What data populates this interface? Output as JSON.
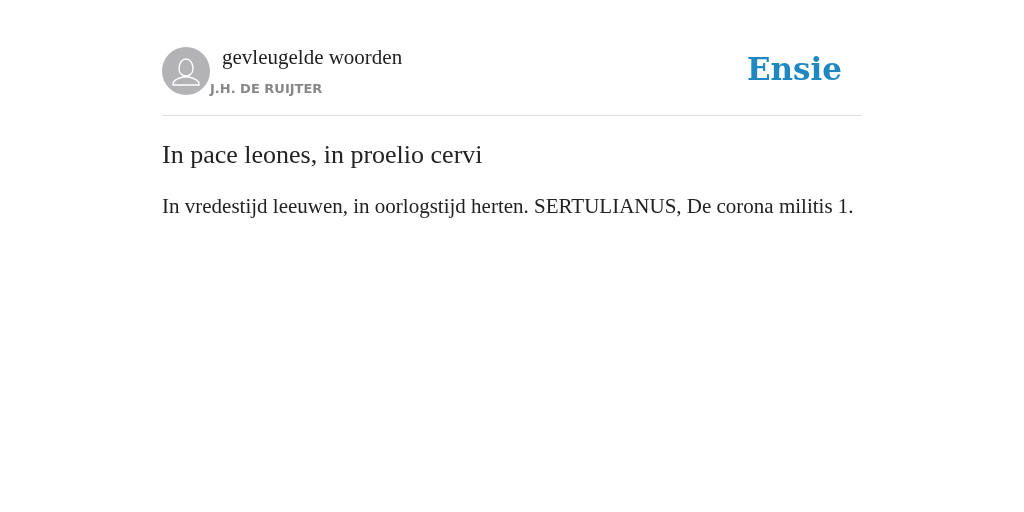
{
  "header": {
    "category": "gevleugelde woorden",
    "author": "J.H. DE RUIJTER",
    "logo": "Ensie"
  },
  "entry": {
    "title": "In pace leones, in proelio cervi",
    "text": "In vredestijd leeuwen, in oorlogstijd herten. SERTULIANUS, De corona militis 1."
  }
}
